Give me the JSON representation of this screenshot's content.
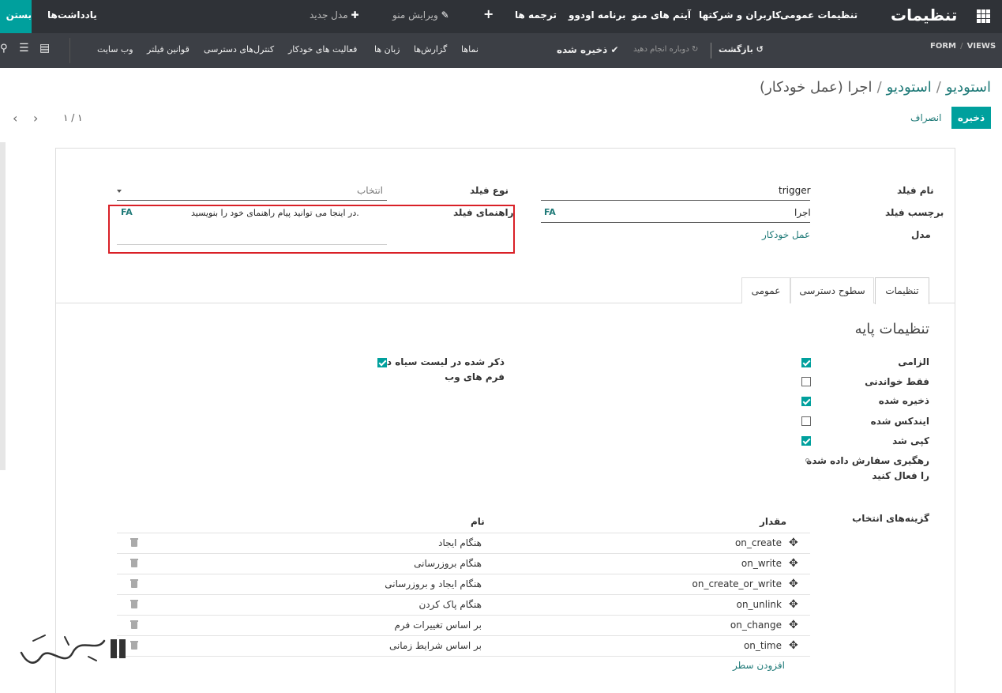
{
  "topbar": {
    "app_title": "تنظیمات",
    "menu": [
      "تنظیمات عمومی",
      "کاربران و شرکتها",
      "آیتم های منو",
      "برنامه اودوو",
      "ترجمه ها"
    ],
    "plus": "+",
    "edit_menu": "ویرایش منو",
    "new_model": "مدل جدید",
    "notes": "یادداشت‌ها",
    "close": "بستن"
  },
  "subbar": {
    "views": "VIEWS",
    "form": "FORM",
    "back": "بازگشت",
    "redo": "دوباره انجام دهید",
    "saved": "ذخیره شده",
    "links": [
      "نماها",
      "گزارش‌ها",
      "زبان ها",
      "فعالیت های خودکار",
      "کنترل‌های دسترسی",
      "قوانین فیلتر",
      "وب سایت"
    ]
  },
  "breadcrumb": {
    "level1": "استودیو",
    "level2": "استودیو",
    "current": "اجرا (عمل خودکار)"
  },
  "controls": {
    "save": "ذخیره",
    "discard": "انصراف",
    "pager": "۱ / ۱"
  },
  "form": {
    "field_name_label": "نام فیلد",
    "field_name_value": "trigger",
    "field_label_label": "برچسب فیلد",
    "field_label_value": "اجرا",
    "lang_badge": "FA",
    "model_label": "مدل",
    "model_value": "عمل خودکار",
    "field_type_label": "نوع فیلد",
    "field_type_value": "انتخاب",
    "help_label": "راهنمای فیلد",
    "help_value": "در اینجا می توانید پیام راهنمای خود را بنویسید."
  },
  "tabs": [
    "تنظیمات",
    "سطوح دسترسی",
    "عمومی"
  ],
  "settings": {
    "title": "تنظیمات پایه",
    "options": [
      {
        "label": "الزامی",
        "checked": true
      },
      {
        "label": "فقط خواندنی",
        "checked": false
      },
      {
        "label": "ذخیره شده",
        "checked": true
      },
      {
        "label": "ایندکس شده",
        "checked": false
      },
      {
        "label": "کپی شد",
        "checked": true
      }
    ],
    "tracking_label_1": "رهگیری سفارش داده شده",
    "tracking_label_2": "را فعال کنید",
    "blacklist_label_1": "ذکر شده در لیست سیاه در",
    "blacklist_label_2": "فرم های وب",
    "blacklist_checked": true
  },
  "selection": {
    "label": "گزینه‌های انتخاب",
    "col_value": "مقدار",
    "col_name": "نام",
    "rows": [
      {
        "value": "on_create",
        "name": "هنگام ایجاد"
      },
      {
        "value": "on_write",
        "name": "هنگام بروزرسانی"
      },
      {
        "value": "on_create_or_write",
        "name": "هنگام ایجاد و بروزرسانی"
      },
      {
        "value": "on_unlink",
        "name": "هنگام پاک کردن"
      },
      {
        "value": "on_change",
        "name": "بر اساس تغییرات فرم"
      },
      {
        "value": "on_time",
        "name": "بر اساس شرایط زمانی"
      }
    ],
    "add_row": "افزودن سطر"
  }
}
